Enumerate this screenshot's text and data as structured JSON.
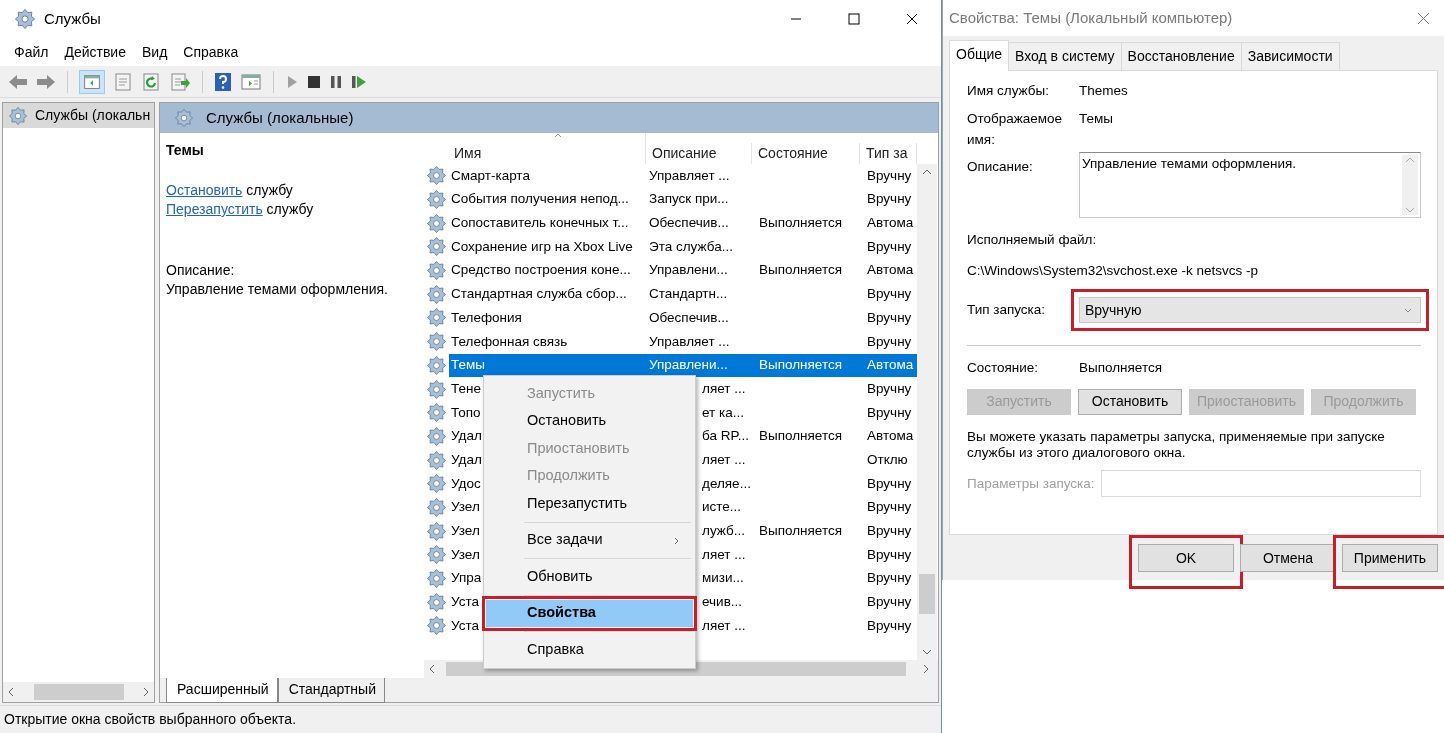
{
  "services_window": {
    "title": "Службы",
    "menu": [
      "Файл",
      "Действие",
      "Вид",
      "Справка"
    ],
    "tree": [
      {
        "label": "Службы (локальн",
        "selected": true
      }
    ],
    "panel_title": "Службы (локальные)",
    "details": {
      "title": "Темы",
      "actions": [
        {
          "link": "Остановить",
          "text": "службу"
        },
        {
          "link": "Перезапустить",
          "text": "службу"
        }
      ],
      "description_label": "Описание:",
      "description": "Управление темами оформления."
    },
    "table": {
      "columns": [
        "Имя",
        "Описание",
        "Состояние",
        "Тип за"
      ],
      "rows": [
        {
          "name": "Смарт-карта",
          "description": "Управляет ...",
          "status": "",
          "startup": "Вручну",
          "selected": false,
          "covered": false
        },
        {
          "name": "События получения непод...",
          "description": "Запуск при...",
          "status": "",
          "startup": "Вручну",
          "selected": false,
          "covered": false
        },
        {
          "name": "Сопоставитель конечных т...",
          "description": "Обеспечив...",
          "status": "Выполняется",
          "startup": "Автома",
          "selected": false,
          "covered": false
        },
        {
          "name": "Сохранение игр на Xbox Live",
          "description": "Эта служба...",
          "status": "",
          "startup": "Вручну",
          "selected": false,
          "covered": false
        },
        {
          "name": "Средство построения коне...",
          "description": "Управлени...",
          "status": "Выполняется",
          "startup": "Автома",
          "selected": false,
          "covered": false
        },
        {
          "name": "Стандартная служба сбор...",
          "description": "Стандартн...",
          "status": "",
          "startup": "Вручну",
          "selected": false,
          "covered": false
        },
        {
          "name": "Телефония",
          "description": "Обеспечив...",
          "status": "",
          "startup": "Вручну",
          "selected": false,
          "covered": false
        },
        {
          "name": "Телефонная связь",
          "description": "Управляет ...",
          "status": "",
          "startup": "Вручну",
          "selected": false,
          "covered": false
        },
        {
          "name": "Темы",
          "description": "Управлени...",
          "status": "Выполняется",
          "startup": "Автома",
          "selected": true,
          "covered": false
        },
        {
          "name": "Тене",
          "description": "ляет ...",
          "status": "",
          "startup": "Вручну",
          "selected": false,
          "covered": true
        },
        {
          "name": "Топо",
          "description": "ет ка...",
          "status": "",
          "startup": "Вручну",
          "selected": false,
          "covered": true
        },
        {
          "name": "Удал",
          "description": "ба RP...",
          "status": "Выполняется",
          "startup": "Автома",
          "selected": false,
          "covered": true
        },
        {
          "name": "Удал",
          "description": "ляет ...",
          "status": "",
          "startup": "Отклю",
          "selected": false,
          "covered": true
        },
        {
          "name": "Удос",
          "description": "деляе...",
          "status": "",
          "startup": "Вручну",
          "selected": false,
          "covered": true
        },
        {
          "name": "Узел",
          "description": "исте...",
          "status": "",
          "startup": "Вручну",
          "selected": false,
          "covered": true
        },
        {
          "name": "Узел",
          "description": "лужб...",
          "status": "Выполняется",
          "startup": "Вручну",
          "selected": false,
          "covered": true
        },
        {
          "name": "Узел",
          "description": "ляет ...",
          "status": "",
          "startup": "Вручну",
          "selected": false,
          "covered": true
        },
        {
          "name": "Упра",
          "description": "мизи...",
          "status": "",
          "startup": "Вручну",
          "selected": false,
          "covered": true
        },
        {
          "name": "Уста",
          "description": "ечив...",
          "status": "",
          "startup": "Вручну",
          "selected": false,
          "covered": true
        },
        {
          "name": "Уста",
          "description": "ляет ...",
          "status": "",
          "startup": "Вручну",
          "selected": false,
          "covered": true
        }
      ]
    },
    "view_tabs": [
      {
        "label": "Расширенный",
        "selected": true
      },
      {
        "label": "Стандартный",
        "selected": false
      }
    ],
    "status_bar": "Открытие окна свойств выбранного объекта."
  },
  "context_menu": {
    "items": [
      {
        "kind": "item",
        "label": "Запустить",
        "disabled": true,
        "selected": false,
        "marked": false
      },
      {
        "kind": "item",
        "label": "Остановить",
        "disabled": false,
        "selected": false,
        "marked": false
      },
      {
        "kind": "item",
        "label": "Приостановить",
        "disabled": true,
        "selected": false,
        "marked": false
      },
      {
        "kind": "item",
        "label": "Продолжить",
        "disabled": true,
        "selected": false,
        "marked": false
      },
      {
        "kind": "item",
        "label": "Перезапустить",
        "disabled": false,
        "selected": false,
        "marked": false
      },
      {
        "kind": "separator"
      },
      {
        "kind": "submenu",
        "label": "Все задачи",
        "disabled": false,
        "selected": false,
        "marked": false
      },
      {
        "kind": "separator"
      },
      {
        "kind": "item",
        "label": "Обновить",
        "disabled": false,
        "selected": false,
        "marked": false
      },
      {
        "kind": "separator"
      },
      {
        "kind": "default",
        "label": "Свойства",
        "disabled": false,
        "selected": true,
        "marked": true
      },
      {
        "kind": "separator"
      },
      {
        "kind": "item",
        "label": "Справка",
        "disabled": false,
        "selected": false,
        "marked": false
      }
    ]
  },
  "properties_dialog": {
    "title": "Свойства: Темы (Локальный компьютер)",
    "tabs": [
      {
        "label": "Общие",
        "selected": true
      },
      {
        "label": "Вход в систему",
        "selected": false
      },
      {
        "label": "Восстановление",
        "selected": false
      },
      {
        "label": "Зависимости",
        "selected": false
      }
    ],
    "service_name_label": "Имя службы:",
    "service_name": "Themes",
    "display_name_label": "Отображаемое имя:",
    "display_name": "Темы",
    "description_label": "Описание:",
    "description": "Управление темами оформления.",
    "executable_label": "Исполняемый файл:",
    "executable": "C:\\Windows\\System32\\svchost.exe -k netsvcs -p",
    "startup_type_label": "Тип запуска:",
    "startup_type": {
      "value": "Вручную",
      "marked": true
    },
    "status_label": "Состояние:",
    "status": "Выполняется",
    "control_buttons": [
      {
        "label": "Запустить",
        "disabled": true
      },
      {
        "label": "Остановить",
        "disabled": false
      },
      {
        "label": "Приостановить",
        "disabled": true
      },
      {
        "label": "Продолжить",
        "disabled": true
      }
    ],
    "hint": "Вы можете указать параметры запуска, применяемые при запуске службы из этого диалогового окна.",
    "parameters": {
      "label": "Параметры запуска:",
      "disabled": true
    },
    "buttons": [
      {
        "label": "OK",
        "marked": true
      },
      {
        "label": "Отмена",
        "marked": false
      },
      {
        "label": "Применить",
        "marked": true
      }
    ]
  }
}
